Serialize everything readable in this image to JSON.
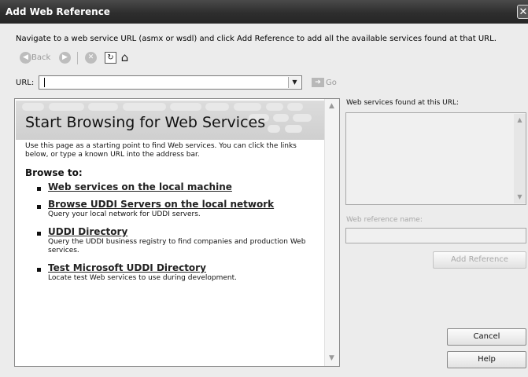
{
  "window": {
    "title": "Add Web Reference",
    "close_glyph": "✕"
  },
  "instructions": "Navigate to a web service URL (asmx or wsdl) and click Add Reference to add all the available services found at that URL.",
  "toolbar": {
    "back_label": "Back",
    "back_icon": "back-arrow-icon",
    "forward_icon": "forward-arrow-icon",
    "stop_icon": "stop-icon",
    "refresh_icon": "refresh-icon",
    "home_icon": "home-icon"
  },
  "url_bar": {
    "label": "URL:",
    "value": "",
    "go_label": "Go"
  },
  "browser": {
    "heading": "Start Browsing for Web Services",
    "intro": "Use this page as a starting point to find Web services. You can click the links below, or type a known URL into the address bar.",
    "browse_to": "Browse to:",
    "items": [
      {
        "link": "Web services on the local machine",
        "desc": ""
      },
      {
        "link": "Browse UDDI Servers on the local network",
        "desc": "Query your local network for UDDI servers."
      },
      {
        "link": "UDDI Directory",
        "desc": "Query the UDDI business registry to find companies and production Web services."
      },
      {
        "link": "Test Microsoft UDDI Directory",
        "desc": "Locate test Web services to use during development."
      }
    ]
  },
  "right_panel": {
    "found_label": "Web services found at this URL:",
    "ref_name_label": "Web reference name:",
    "ref_name_value": ""
  },
  "buttons": {
    "add_reference": "Add Reference",
    "cancel": "Cancel",
    "help": "Help"
  },
  "colors": {
    "titlebar": "#2e2e2e",
    "link": "#222222",
    "disabled_text": "#a8a8a8"
  }
}
